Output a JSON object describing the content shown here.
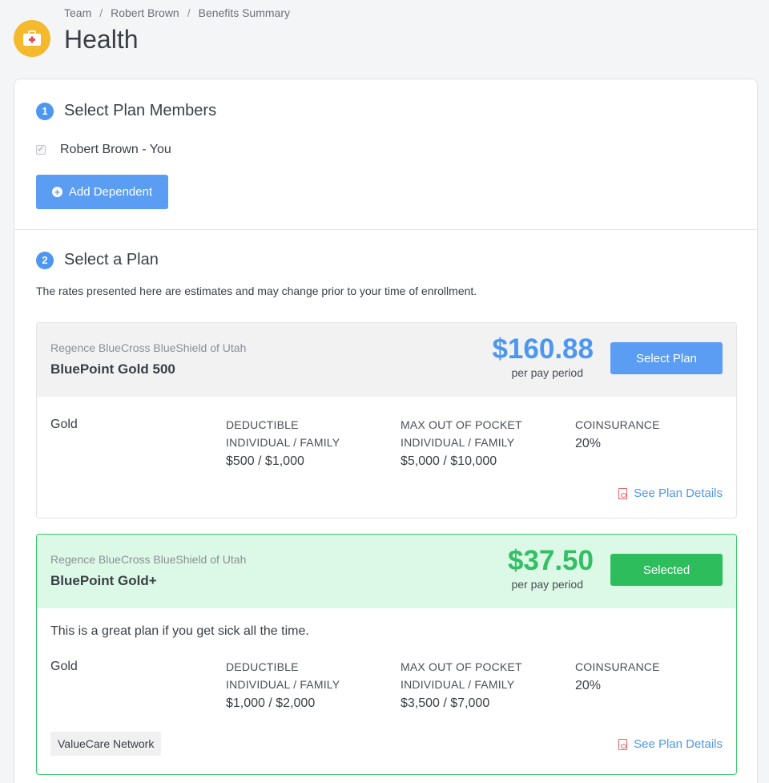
{
  "breadcrumb": [
    "Team",
    "Robert Brown",
    "Benefits Summary"
  ],
  "page": {
    "title": "Health",
    "icon": "medical-kit-icon",
    "icon_color": "#f5b92e"
  },
  "step1": {
    "number": "1",
    "title": "Select Plan Members",
    "members": [
      {
        "name": "Robert Brown - You",
        "checked": true
      }
    ],
    "add_dependent_label": "Add Dependent"
  },
  "step2": {
    "number": "2",
    "title": "Select a Plan",
    "disclaimer": "The rates presented here are estimates and may change prior to your time of enrollment."
  },
  "plans": [
    {
      "carrier": "Regence BlueCross BlueShield of Utah",
      "name": "BluePoint Gold 500",
      "price": "$160.88",
      "period": "per pay period",
      "button_label": "Select Plan",
      "tier": "Gold",
      "deductible_label": [
        "DEDUCTIBLE",
        "INDIVIDUAL / FAMILY"
      ],
      "deductible_value": "$500 / $1,000",
      "oop_label": [
        "MAX OUT OF POCKET",
        "INDIVIDUAL / FAMILY"
      ],
      "oop_value": "$5,000 / $10,000",
      "coinsurance_label": "COINSURANCE",
      "coinsurance_value": "20%",
      "details_label": "See Plan Details"
    },
    {
      "carrier": "Regence BlueCross BlueShield of Utah",
      "name": "BluePoint Gold+",
      "price": "$37.50",
      "period": "per pay period",
      "button_label": "Selected",
      "blurb": "This is a great plan if you get sick all the time.",
      "tier": "Gold",
      "deductible_label": [
        "DEDUCTIBLE",
        "INDIVIDUAL / FAMILY"
      ],
      "deductible_value": "$1,000 / $2,000",
      "oop_label": [
        "MAX OUT OF POCKET",
        "INDIVIDUAL / FAMILY"
      ],
      "oop_value": "$3,500 / $7,000",
      "coinsurance_label": "COINSURANCE",
      "coinsurance_value": "20%",
      "network": "ValueCare Network",
      "details_label": "See Plan Details"
    }
  ],
  "colors": {
    "accent_blue": "#4d97f0",
    "selected_green": "#32c064"
  }
}
